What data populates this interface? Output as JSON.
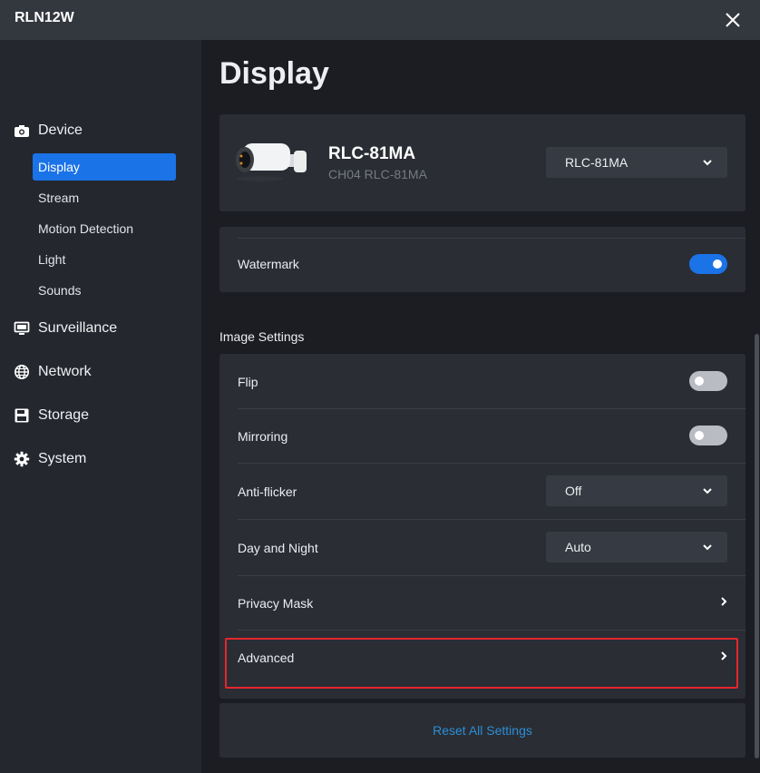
{
  "window": {
    "title": "RLN12W"
  },
  "sidebar": {
    "device": {
      "label": "Device",
      "items": [
        {
          "label": "Display",
          "active": true
        },
        {
          "label": "Stream"
        },
        {
          "label": "Motion Detection"
        },
        {
          "label": "Light"
        },
        {
          "label": "Sounds"
        }
      ]
    },
    "groups": [
      {
        "label": "Surveillance",
        "icon": "monitor-icon"
      },
      {
        "label": "Network",
        "icon": "globe-icon"
      },
      {
        "label": "Storage",
        "icon": "storage-icon"
      },
      {
        "label": "System",
        "icon": "gear-icon"
      }
    ]
  },
  "main": {
    "title": "Display",
    "device_card": {
      "name": "RLC-81MA",
      "subtitle": "CH04 RLC-81MA",
      "selector_value": "RLC-81MA"
    },
    "watermark": {
      "label": "Watermark",
      "enabled": true
    },
    "image_settings": {
      "title": "Image Settings",
      "flip": {
        "label": "Flip",
        "enabled": false
      },
      "mirroring": {
        "label": "Mirroring",
        "enabled": false
      },
      "anti_flicker": {
        "label": "Anti-flicker",
        "value": "Off"
      },
      "day_night": {
        "label": "Day and Night",
        "value": "Auto"
      },
      "privacy_mask": {
        "label": "Privacy Mask"
      },
      "advanced": {
        "label": "Advanced"
      }
    },
    "reset": {
      "label": "Reset All Settings"
    }
  },
  "colors": {
    "accent": "#1b73e8",
    "link": "#2c8ed6",
    "highlight": "#e5262c"
  }
}
